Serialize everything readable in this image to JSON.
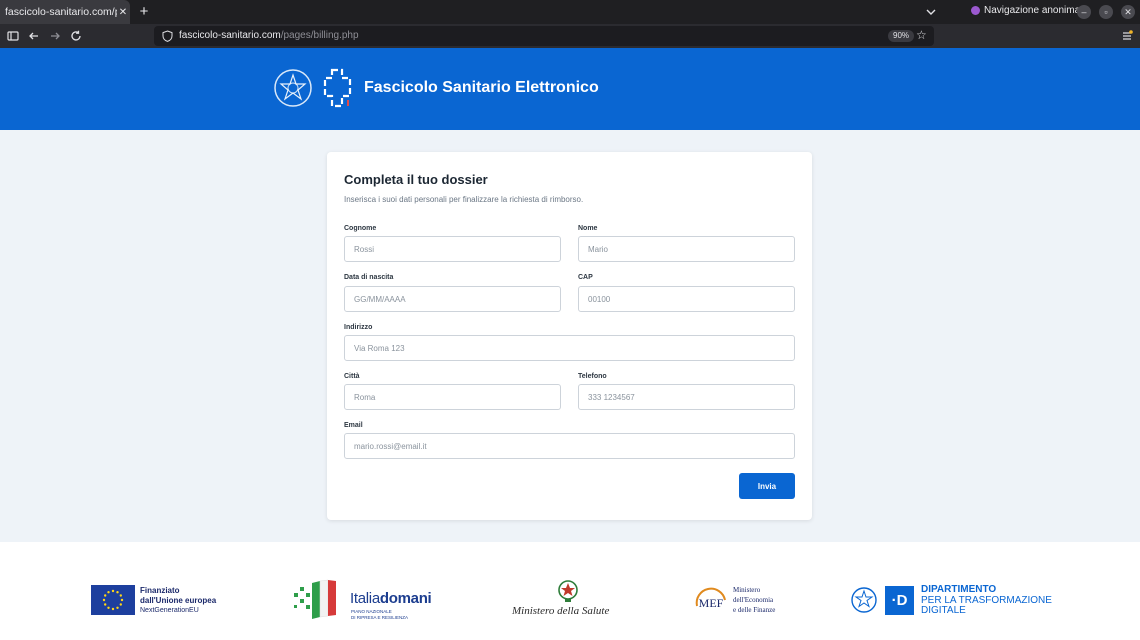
{
  "browser": {
    "tab_title": "fascicolo-sanitario.com/page",
    "tab_close": "✕",
    "new_tab": "+",
    "private_label": "Navigazione anonima",
    "url_host": "fascicolo-sanitario.com",
    "url_path": "/pages/billing.php",
    "zoom": "90%",
    "private_color": "#9b59d0"
  },
  "header": {
    "title": "Fascicolo Sanitario Elettronico",
    "color": "#0a66d2"
  },
  "form": {
    "title": "Completa il tuo dossier",
    "subtitle": "Inserisca i suoi dati personali per finalizzare la richiesta di rimborso.",
    "fields": {
      "cognome": {
        "label": "Cognome",
        "placeholder": "Rossi"
      },
      "nome": {
        "label": "Nome",
        "placeholder": "Mario"
      },
      "data_nascita": {
        "label": "Data di nascita",
        "placeholder": "GG/MM/AAAA"
      },
      "cap": {
        "label": "CAP",
        "placeholder": "00100"
      },
      "indirizzo": {
        "label": "Indirizzo",
        "placeholder": "Via Roma 123"
      },
      "citta": {
        "label": "Città",
        "placeholder": "Roma"
      },
      "telefono": {
        "label": "Telefono",
        "placeholder": "333 1234567"
      },
      "email": {
        "label": "Email",
        "placeholder": "mario.rossi@email.it"
      }
    },
    "submit_label": "Invia"
  },
  "footer": {
    "eu": {
      "line1": "Finanziato",
      "line2": "dall'Unione europea",
      "line3": "NextGenerationEU"
    },
    "italiadomani": {
      "name_light": "Italia",
      "name_bold": "domani",
      "sub1": "PIANO NAZIONALE",
      "sub2": "DI RIPRESA E RESILIENZA"
    },
    "ministero_salute": "Ministero della Salute",
    "mef": {
      "mark": "MEF",
      "line1": "Ministero",
      "line2": "dell'Economia",
      "line3": "e delle Finanze"
    },
    "dtd": {
      "box": "·D",
      "line1": "DIPARTIMENTO",
      "line2": "PER LA TRASFORMAZIONE",
      "line3": "DIGITALE"
    }
  }
}
